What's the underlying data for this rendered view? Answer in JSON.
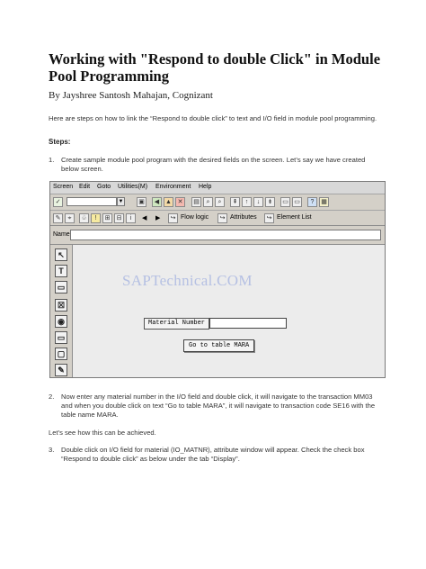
{
  "document": {
    "title": "Working with \"Respond to double Click\" in Module Pool Programming",
    "byline": "By Jayshree Santosh Mahajan, Cognizant",
    "intro": "Here are steps on how to link the “Respond to double click” to text and I/O field in module pool programming.",
    "steps_heading": "Steps:",
    "step1": {
      "number": "1.",
      "text": "Create sample module pool program with the desired fields on the screen. Let’s say we have created below screen."
    },
    "step2": {
      "number": "2.",
      "text": "Now enter any material number in the I/O field and double click, it will navigate to the transaction MM03 and when you double click on text “Go to table MARA”, it will navigate to transaction code SE16 with the table name MARA."
    },
    "lets_see": "Let’s see how this can be achieved.",
    "step3": {
      "number": "3.",
      "text": "Double click on I/O field for material (IO_MATNR), attribute window will appear. Check the check box “Respond to double click” as below under the tab “Display”."
    }
  },
  "sap_screen": {
    "menu": [
      "Screen",
      "Edit",
      "Goto",
      "Utilities(M)",
      "Environment",
      "Help"
    ],
    "app_toolbar": {
      "flow_logic": "Flow logic",
      "attributes": "Attributes",
      "element_list": "Element List"
    },
    "name_label": "Name",
    "watermark": "SAPTechnical.COM",
    "material_label": "Material Number",
    "material_value": "",
    "go_button": "Go to table MARA"
  }
}
